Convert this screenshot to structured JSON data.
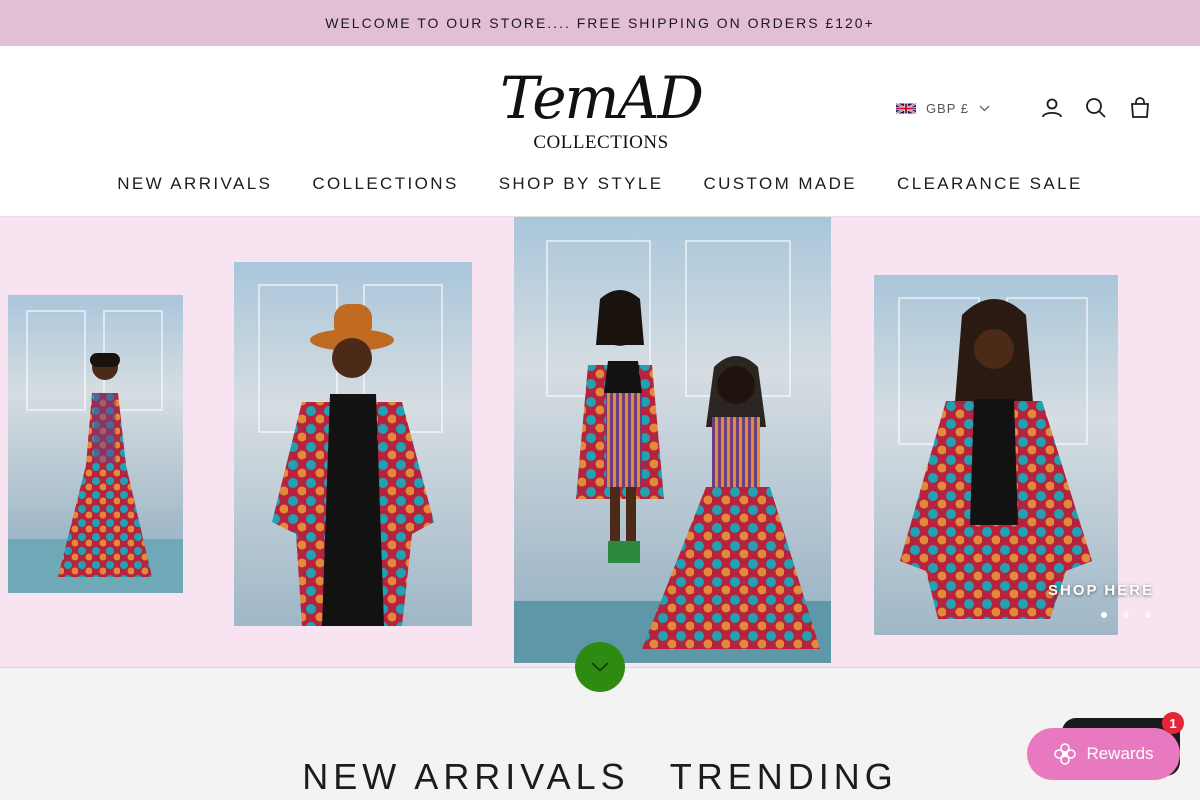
{
  "announcement": "WELCOME TO OUR STORE.... FREE SHIPPING ON ORDERS £120+",
  "brand": {
    "logo_text": "TemAD",
    "logo_sub": "COLLECTIONS"
  },
  "header": {
    "currency": "GBP £"
  },
  "nav": [
    "NEW ARRIVALS",
    "COLLECTIONS",
    "SHOP BY STYLE",
    "CUSTOM MADE",
    "CLEARANCE SALE"
  ],
  "hero": {
    "cta": "SHOP HERE",
    "slide_count": 3,
    "active_slide": 1
  },
  "sections": {
    "tabs": [
      "NEW ARRIVALS",
      "TRENDING"
    ]
  },
  "rewards": {
    "label": "Rewards",
    "badge": "1"
  },
  "colors": {
    "announcement_bg": "#e3bfd5",
    "hero_bg": "#f7e4f0",
    "scroll_button": "#2f8a12",
    "rewards_bg": "#e879c1",
    "badge": "#e5263a"
  },
  "icons": [
    "uk-flag-icon",
    "chevron-down-icon",
    "account-icon",
    "search-icon",
    "cart-icon",
    "flower-icon"
  ]
}
